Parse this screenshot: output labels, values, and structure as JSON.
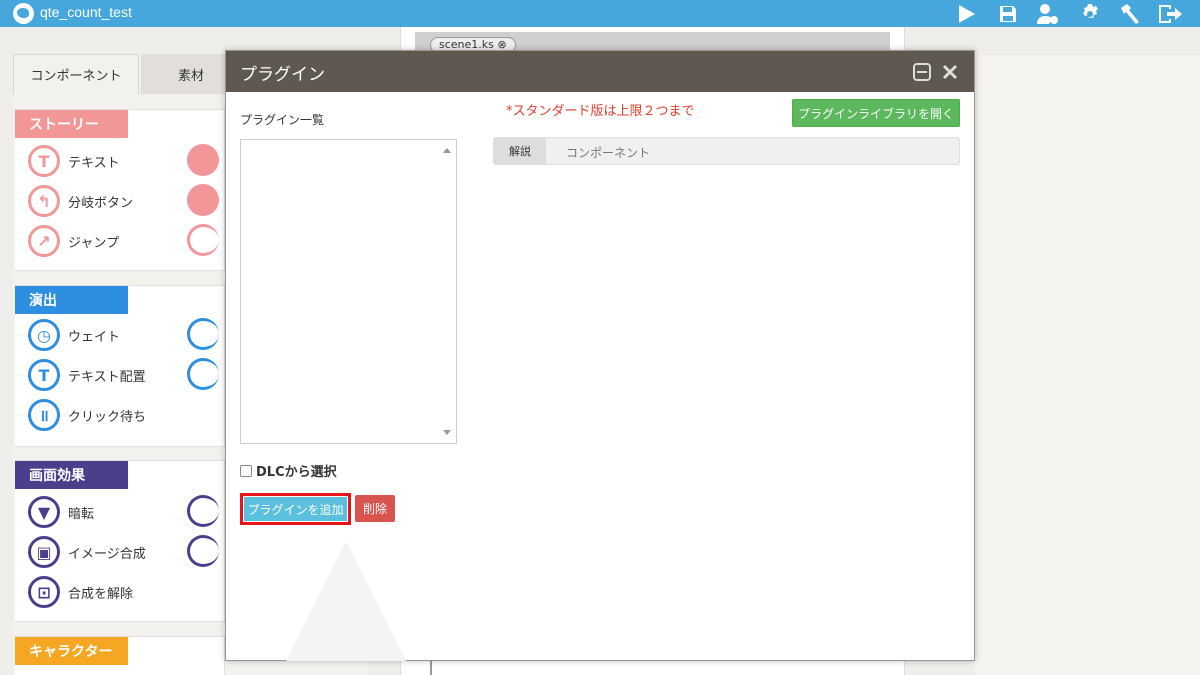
{
  "app": {
    "title": "qte_count_test"
  },
  "toolbar": {
    "icons": [
      "play-icon",
      "save-icon",
      "user-settings-icon",
      "gear-icon",
      "hammer-icon",
      "exit-icon"
    ]
  },
  "left_panel": {
    "tabs": [
      {
        "label": "コンポーネント"
      },
      {
        "label": "素材"
      }
    ],
    "sections": [
      {
        "title": "ストーリー",
        "color": "#f19797",
        "items": [
          {
            "label": "テキスト",
            "icon": "T"
          },
          {
            "label": "分岐ボタン",
            "icon": "↰"
          },
          {
            "label": "ジャンプ",
            "icon": "↗"
          }
        ]
      },
      {
        "title": "演出",
        "color": "#2e8fe0",
        "items": [
          {
            "label": "ウェイト",
            "icon": "◷"
          },
          {
            "label": "テキスト配置",
            "icon": "T"
          },
          {
            "label": "クリック待ち",
            "icon": "॥"
          }
        ]
      },
      {
        "title": "画面効果",
        "color": "#4b3f8c",
        "items": [
          {
            "label": "暗転",
            "icon": "▼"
          },
          {
            "label": "イメージ合成",
            "icon": "▣"
          },
          {
            "label": "合成を解除",
            "icon": "⊡"
          }
        ]
      },
      {
        "title": "キャラクター",
        "color": "#f5a623",
        "items": []
      }
    ]
  },
  "scene": {
    "tab_label": "scene1.ks ⊗"
  },
  "dialog": {
    "title": "プラグイン",
    "list_label": "プラグイン一覧",
    "limit_note": "*スタンダード版は上限２つまで",
    "library_button": "プラグインライブラリを開く",
    "desc_tab": "解説",
    "desc_component": "コンポーネント",
    "dlc_label": "DLCから選択",
    "dlc_checked": false,
    "add_button": "プラグインを追加",
    "delete_button": "削除"
  }
}
